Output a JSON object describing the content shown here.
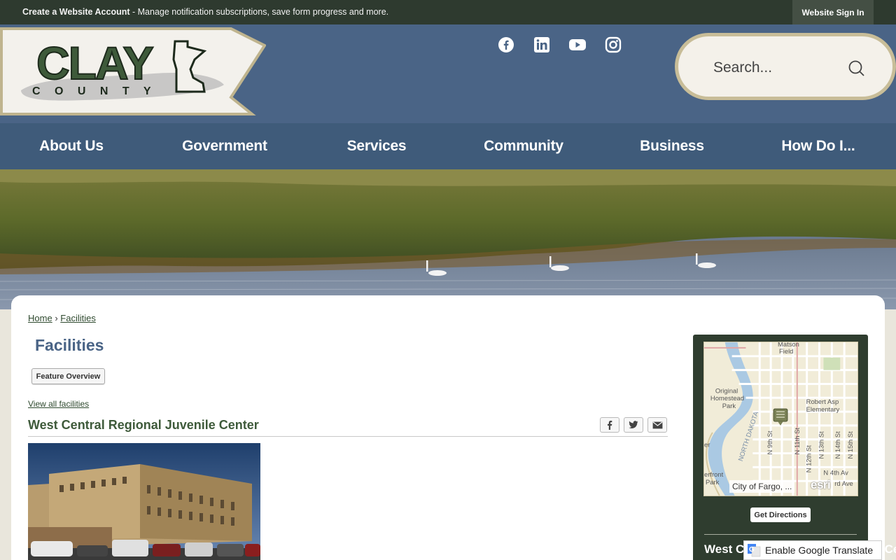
{
  "topbar": {
    "account_link": "Create a Website Account",
    "account_desc": " - Manage notification subscriptions, save form progress and more.",
    "signin_label": "Website Sign In"
  },
  "header": {
    "logo_word": "CLAY",
    "logo_sub": "C O U N T Y",
    "social": [
      "facebook-icon",
      "linkedin-icon",
      "youtube-icon",
      "instagram-icon"
    ],
    "search_placeholder": "Search..."
  },
  "nav": {
    "items": [
      {
        "label": "About Us"
      },
      {
        "label": "Government"
      },
      {
        "label": "Services"
      },
      {
        "label": "Community"
      },
      {
        "label": "Business"
      },
      {
        "label": "How Do I..."
      }
    ]
  },
  "breadcrumb": {
    "home": "Home",
    "sep": "›",
    "current": "Facilities"
  },
  "page": {
    "title": "Facilities",
    "feature_overview": "Feature Overview",
    "view_all": "View all facilities",
    "facility_title": "West Central Regional Juvenile Center"
  },
  "share": [
    "facebook-share-icon",
    "twitter-share-icon",
    "email-share-icon"
  ],
  "map": {
    "labels": {
      "field": "Field",
      "matson": "Matson",
      "original": "Original",
      "homestead": "Homestead",
      "park": "Park",
      "robert_asp": "Robert Asp",
      "elementary": "Elementary",
      "north_dakota": "NORTH DAKOTA",
      "n9": "N 9th St",
      "n11": "N 11th St",
      "n12": "N 12th St",
      "n13": "N 13th St",
      "n14": "N 14th St",
      "n15": "N 15th St",
      "n4av": "N 4th Av",
      "rd_ave": "rd Ave",
      "er": "er",
      "erfront": "erfront",
      "park2": "Park"
    },
    "attribution": "City of Fargo, ...",
    "esri": "esri"
  },
  "sidebar": {
    "directions": "Get Directions",
    "title": "West Central Regional Juvenile Center"
  },
  "translate": {
    "label": "Enable Google Translate"
  },
  "colors": {
    "topbar": "#2e3a2f",
    "header": "#4a6486",
    "nav": "#3f5b7a",
    "accent_green": "#3e5a3a",
    "title_blue": "#4a6486"
  }
}
